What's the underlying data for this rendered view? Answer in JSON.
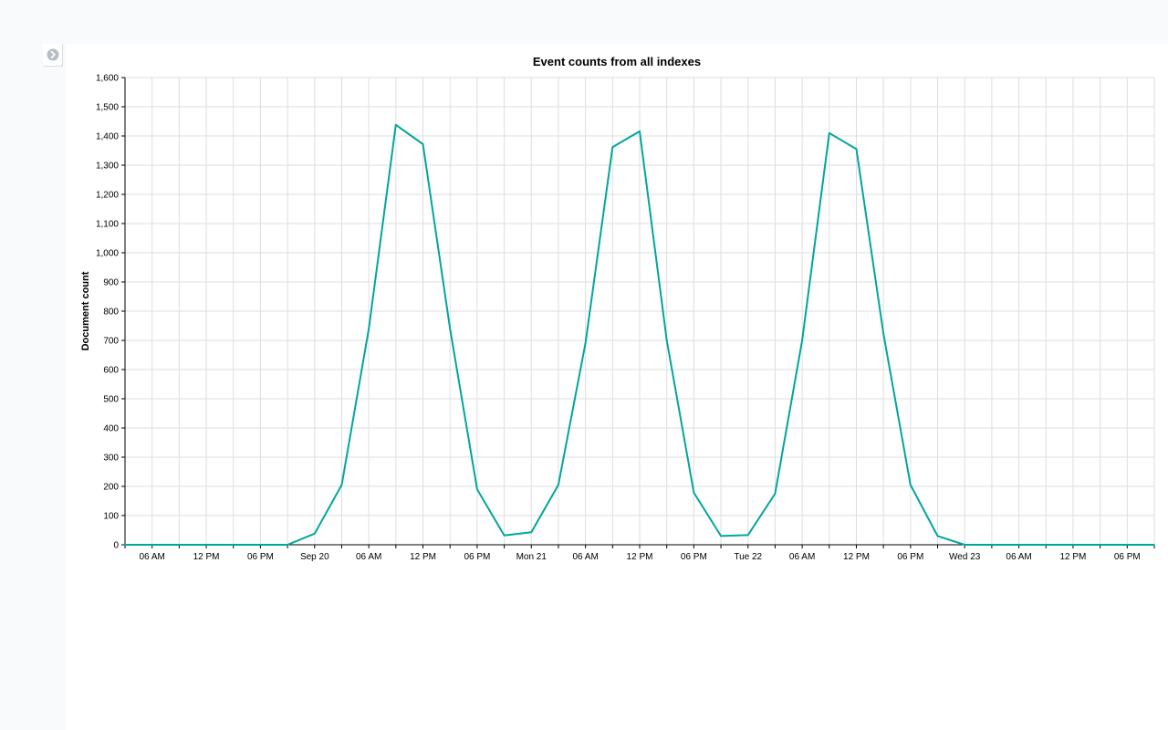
{
  "sidebar": {
    "toggle_icon": "chevron-right-circle-icon"
  },
  "colors": {
    "line": "#00a69b",
    "grid": "#dedede",
    "background": "#ffffff",
    "chrome": "#f9fafb"
  },
  "chart_data": {
    "type": "line",
    "title": "Event counts from all indexes",
    "xlabel": "",
    "ylabel": "Document count",
    "ylim": [
      0,
      1600
    ],
    "yticks": [
      0,
      100,
      200,
      300,
      400,
      500,
      600,
      700,
      800,
      900,
      1000,
      1100,
      1200,
      1300,
      1400,
      1500,
      1600
    ],
    "ytick_labels": [
      "0",
      "100",
      "200",
      "300",
      "400",
      "500",
      "600",
      "700",
      "800",
      "900",
      "1,000",
      "1,100",
      "1,200",
      "1,300",
      "1,400",
      "1,500",
      "1,600"
    ],
    "xlim": [
      "2019-09-19 03:00",
      "2019-09-23 21:00"
    ],
    "xticks": [
      {
        "at": "2019-09-19 06:00",
        "label": "06 AM"
      },
      {
        "at": "2019-09-19 12:00",
        "label": "12 PM"
      },
      {
        "at": "2019-09-19 18:00",
        "label": "06 PM"
      },
      {
        "at": "2019-09-20 00:00",
        "label": "Sep 20"
      },
      {
        "at": "2019-09-20 06:00",
        "label": "06 AM"
      },
      {
        "at": "2019-09-20 12:00",
        "label": "12 PM"
      },
      {
        "at": "2019-09-20 18:00",
        "label": "06 PM"
      },
      {
        "at": "2019-09-21 00:00",
        "label": "Mon 21"
      },
      {
        "at": "2019-09-21 06:00",
        "label": "06 AM"
      },
      {
        "at": "2019-09-21 12:00",
        "label": "12 PM"
      },
      {
        "at": "2019-09-21 18:00",
        "label": "06 PM"
      },
      {
        "at": "2019-09-22 00:00",
        "label": "Tue 22"
      },
      {
        "at": "2019-09-22 06:00",
        "label": "06 AM"
      },
      {
        "at": "2019-09-22 12:00",
        "label": "12 PM"
      },
      {
        "at": "2019-09-22 18:00",
        "label": "06 PM"
      },
      {
        "at": "2019-09-23 00:00",
        "label": "Wed 23"
      },
      {
        "at": "2019-09-23 06:00",
        "label": "06 AM"
      },
      {
        "at": "2019-09-23 12:00",
        "label": "12 PM"
      },
      {
        "at": "2019-09-23 18:00",
        "label": "06 PM"
      }
    ],
    "grid": true,
    "legend": "none",
    "series": [
      {
        "x": [
          "2019-09-19 03:00",
          "2019-09-19 06:00",
          "2019-09-19 09:00",
          "2019-09-19 12:00",
          "2019-09-19 15:00",
          "2019-09-19 18:00",
          "2019-09-19 21:00",
          "2019-09-20 00:00",
          "2019-09-20 03:00",
          "2019-09-20 06:00",
          "2019-09-20 09:00",
          "2019-09-20 12:00",
          "2019-09-20 15:00",
          "2019-09-20 18:00",
          "2019-09-20 21:00",
          "2019-09-21 00:00",
          "2019-09-21 03:00",
          "2019-09-21 06:00",
          "2019-09-21 09:00",
          "2019-09-21 12:00",
          "2019-09-21 15:00",
          "2019-09-21 18:00",
          "2019-09-21 21:00",
          "2019-09-22 00:00",
          "2019-09-22 03:00",
          "2019-09-22 06:00",
          "2019-09-22 09:00",
          "2019-09-22 12:00",
          "2019-09-22 15:00",
          "2019-09-22 18:00",
          "2019-09-22 21:00",
          "2019-09-23 00:00",
          "2019-09-23 03:00",
          "2019-09-23 06:00",
          "2019-09-23 09:00",
          "2019-09-23 12:00",
          "2019-09-23 15:00",
          "2019-09-23 18:00",
          "2019-09-23 21:00"
        ],
        "y": [
          0,
          0,
          0,
          0,
          0,
          0,
          0,
          38,
          205,
          740,
          1438,
          1372,
          740,
          190,
          32,
          43,
          205,
          690,
          1362,
          1416,
          700,
          178,
          30,
          33,
          175,
          700,
          1410,
          1355,
          722,
          205,
          30,
          0,
          0,
          0,
          0,
          0,
          0,
          0,
          0
        ]
      }
    ]
  }
}
